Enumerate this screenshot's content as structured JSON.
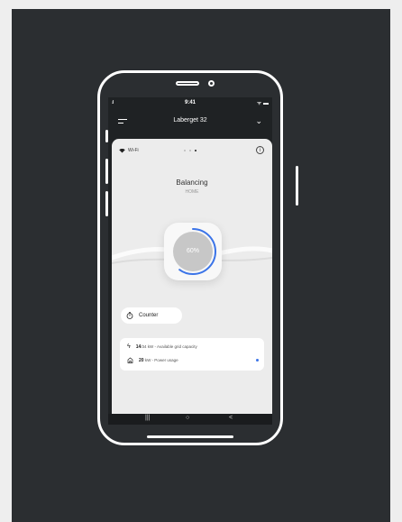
{
  "status_bar": {
    "time": "9:41",
    "signal": ".ıll",
    "right_icons": "ᯤ ▬"
  },
  "app_bar": {
    "location": "Laberget 32"
  },
  "connection": {
    "label": "Wi-Fi"
  },
  "mode": {
    "title": "Balancing",
    "subtitle": "HOME"
  },
  "gauge": {
    "value_label": "60%",
    "progress": 0.6
  },
  "counter": {
    "label": "Counter"
  },
  "grid": {
    "capacity_value": "14",
    "capacity_text": "/34 kW - Available grid capacity",
    "usage_value": "20",
    "usage_text": " kW - Power usage"
  },
  "nav": {
    "recents": "|||",
    "home": "○",
    "back": "<"
  },
  "colors": {
    "background": "#2b2e31",
    "accent": "#3b74e8",
    "screen_bg": "#ececec"
  }
}
